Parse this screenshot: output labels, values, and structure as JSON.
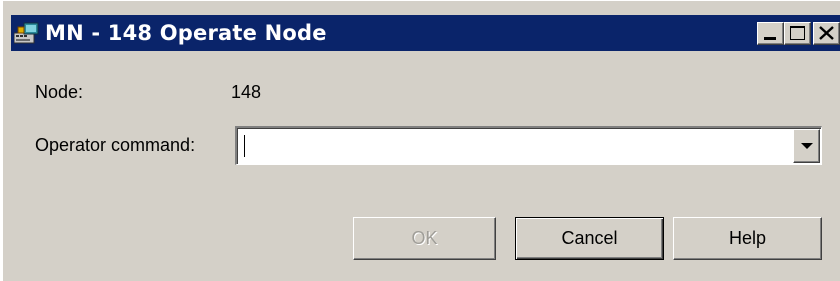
{
  "window": {
    "title": "MN - 148 Operate Node",
    "icon": "node-app-icon",
    "controls": {
      "minimize_icon": "minimize-icon",
      "maximize_icon": "maximize-icon",
      "close_icon": "close-icon"
    }
  },
  "form": {
    "node_label": "Node:",
    "node_value": "148",
    "operator_command_label": "Operator command:",
    "operator_command_value": "",
    "operator_command_placeholder": ""
  },
  "buttons": {
    "ok_label": "OK",
    "ok_enabled": false,
    "cancel_label": "Cancel",
    "help_label": "Help"
  },
  "colors": {
    "titlebar": "#0a246a",
    "dialog_face": "#d4d0c8",
    "disabled_text": "#a09e98"
  }
}
